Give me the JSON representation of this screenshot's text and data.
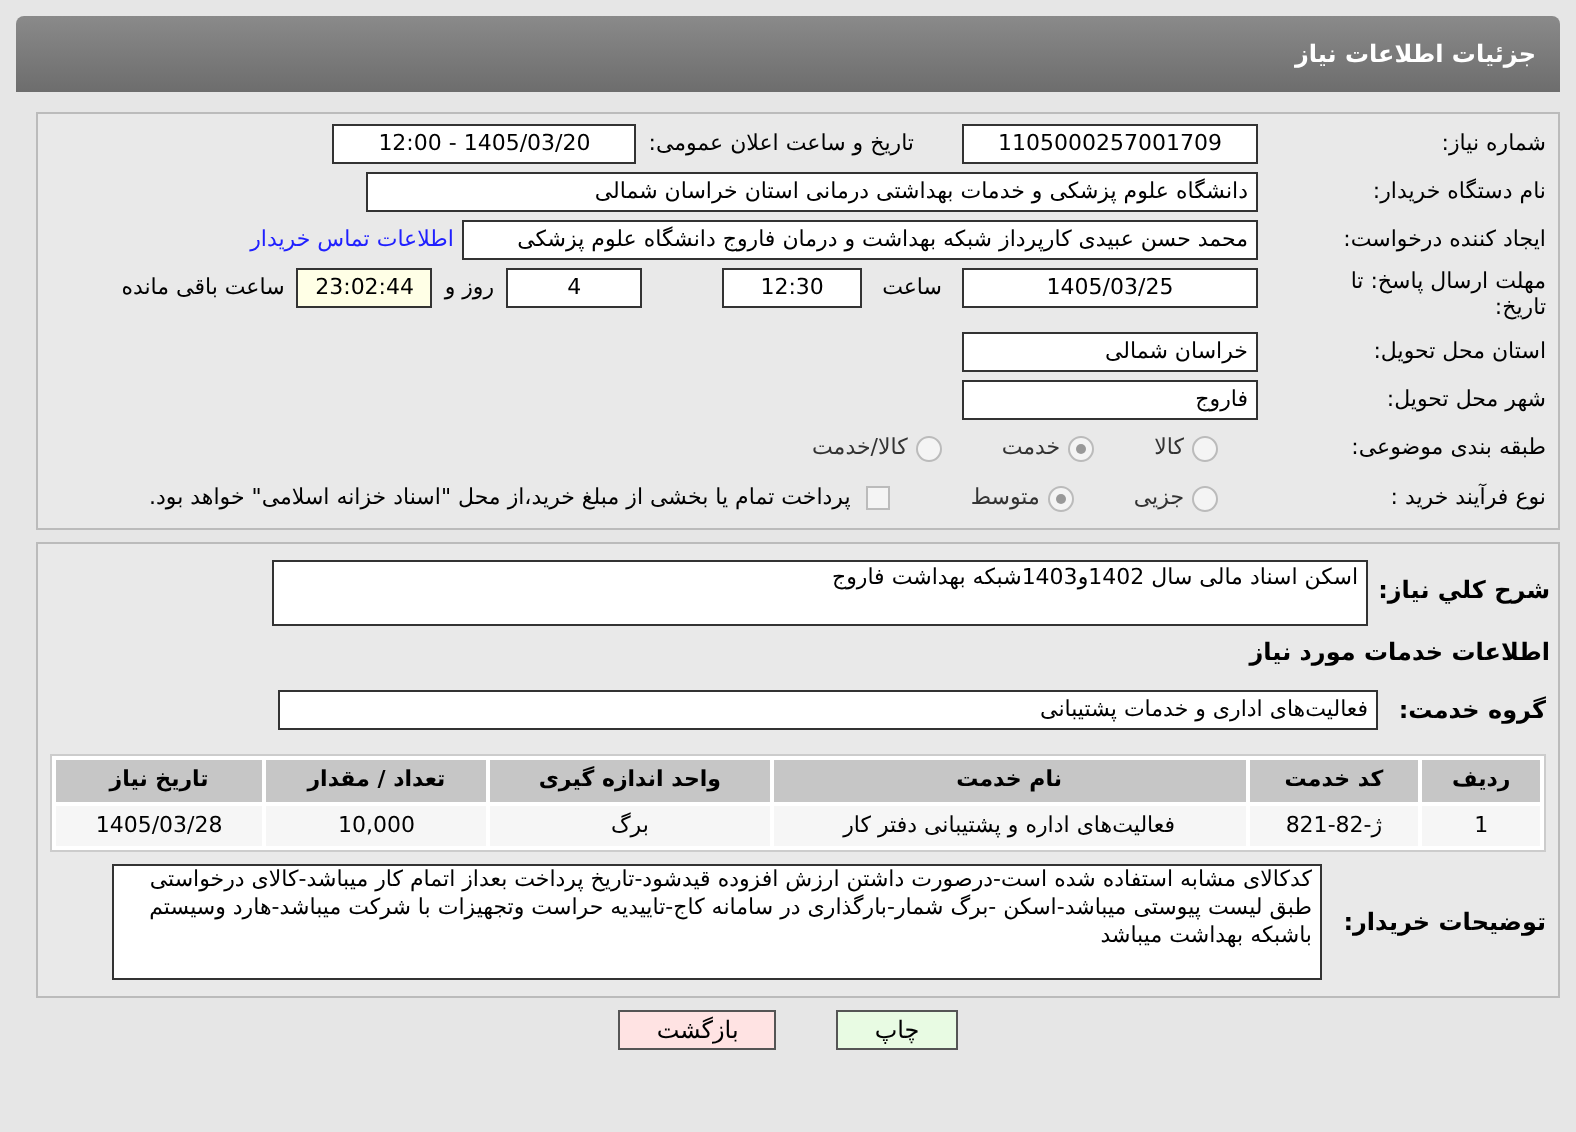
{
  "header": {
    "title": "جزئیات اطلاعات نیاز"
  },
  "need_number": {
    "label": "شماره نیاز:",
    "value": "1105000257001709"
  },
  "announce": {
    "label": "تاریخ و ساعت اعلان عمومی:",
    "value": "1405/03/20 - 12:00"
  },
  "buyer": {
    "label": "نام دستگاه خریدار:",
    "value": "دانشگاه علوم پزشکی و خدمات بهداشتی درمانی استان خراسان شمالی"
  },
  "requester": {
    "label": "ایجاد کننده درخواست:",
    "value": "محمد حسن عبیدی کارپرداز شبکه بهداشت و درمان فاروج دانشگاه علوم پزشکی",
    "link": "اطلاعات تماس خریدار"
  },
  "deadline": {
    "label": "مهلت ارسال پاسخ: تا تاریخ:",
    "date": "1405/03/25",
    "time_label": "ساعت",
    "time": "12:30",
    "days": "4",
    "days_label": "روز و",
    "remaining": "23:02:44",
    "remaining_label": "ساعت باقی مانده"
  },
  "province": {
    "label": "استان محل تحویل:",
    "value": "خراسان شمالی"
  },
  "city": {
    "label": "شهر محل تحویل:",
    "value": "فاروج"
  },
  "category": {
    "label": "طبقه بندی موضوعی:",
    "options": [
      {
        "label": "کالا",
        "selected": false
      },
      {
        "label": "خدمت",
        "selected": true
      },
      {
        "label": "کالا/خدمت",
        "selected": false
      }
    ]
  },
  "process": {
    "label": "نوع فرآیند خرید :",
    "options": [
      {
        "label": "جزیی",
        "selected": false
      },
      {
        "label": "متوسط",
        "selected": true
      }
    ],
    "payment": {
      "label": "پرداخت تمام یا بخشی از مبلغ خرید،از محل \"اسناد خزانه اسلامی\" خواهد بود.",
      "checked": false
    }
  },
  "description": {
    "label": "شرح کلي نياز:",
    "value": "اسکن اسناد مالی سال 1402و1403شبکه بهداشت فاروج"
  },
  "services_title": "اطلاعات خدمات مورد نياز",
  "service_group": {
    "label": "گروه خدمت:",
    "value": "فعالیت‌های اداری و خدمات پشتیبانی"
  },
  "table": {
    "columns": [
      "ردیف",
      "کد خدمت",
      "نام خدمت",
      "واحد اندازه گیری",
      "تعداد / مقدار",
      "تاریخ نیاز"
    ],
    "rows": [
      [
        "1",
        "ژ-82-821",
        "فعالیت‌های اداره و پشتیبانی دفتر کار",
        "برگ",
        "10,000",
        "1405/03/28"
      ]
    ]
  },
  "buyer_notes": {
    "label": "توضیحات خریدار:",
    "value": "کدکالای مشابه استفاده شده است-درصورت داشتن ارزش افزوده قیدشود-تاریخ پرداخت بعداز اتمام کار میباشد-کالای درخواستی طبق لیست پیوستی میباشد-اسکن -برگ شمار-بارگذاری در سامانه کاج-تاییدیه حراست وتجهیزات با شرکت میباشد-هارد وسیستم باشبکه بهداشت میباشد"
  },
  "buttons": [
    {
      "label": "چاپ",
      "kind": "print"
    },
    {
      "label": "بازگشت",
      "kind": "back"
    }
  ]
}
